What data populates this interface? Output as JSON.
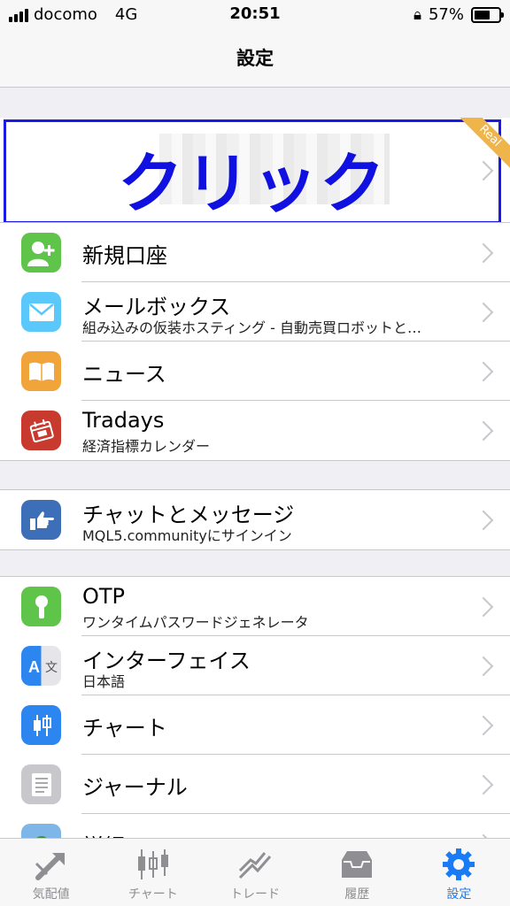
{
  "status": {
    "carrier": "docomo",
    "network": "4G",
    "time": "20:51",
    "battery": "57%"
  },
  "nav": {
    "title": "設定"
  },
  "account": {
    "overlay_text": "クリック",
    "badge": "Real"
  },
  "groups": [
    [
      {
        "title": "新規口座",
        "subtitle": ""
      },
      {
        "title": "メールボックス",
        "subtitle": "組み込みの仮装ホスティング - 自動売買ロボットと…"
      },
      {
        "title": "ニュース",
        "subtitle": ""
      },
      {
        "title": "Tradays",
        "subtitle": "経済指標カレンダー"
      }
    ],
    [
      {
        "title": "チャットとメッセージ",
        "subtitle": "MQL5.communityにサインイン"
      }
    ],
    [
      {
        "title": "OTP",
        "subtitle": "ワンタイムパスワードジェネレータ"
      },
      {
        "title": "インターフェイス",
        "subtitle": "日本語"
      },
      {
        "title": "チャート",
        "subtitle": ""
      },
      {
        "title": "ジャーナル",
        "subtitle": ""
      },
      {
        "title": "詳細",
        "subtitle": ""
      }
    ]
  ],
  "icon_colors": {
    "new_account": "#5fc54a",
    "mailbox": "#5ac8fa",
    "news": "#f0a43a",
    "tradays": "#c8392e",
    "chat": "#3d6fb8",
    "otp": "#5fc54a",
    "interface": "#2d86f0",
    "chart": "#2d86f0",
    "journal": "#c7c7cc",
    "detail": "#7fb6e8"
  },
  "tabbar": {
    "items": [
      {
        "label": "気配値",
        "icon": "quotes-icon"
      },
      {
        "label": "チャート",
        "icon": "chart-icon"
      },
      {
        "label": "トレード",
        "icon": "trade-icon"
      },
      {
        "label": "履歴",
        "icon": "history-icon"
      },
      {
        "label": "設定",
        "icon": "settings-icon"
      }
    ],
    "active_color": "#1a7cf5"
  }
}
